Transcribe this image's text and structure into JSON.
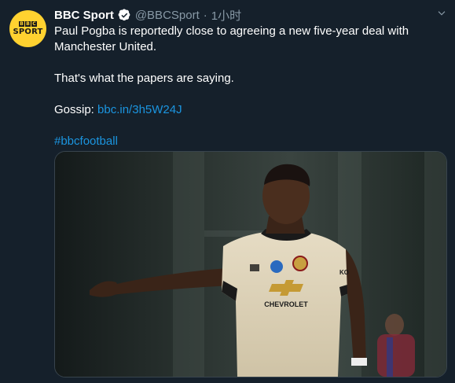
{
  "tweet": {
    "avatar": {
      "logo_letters": [
        "B",
        "B",
        "C"
      ],
      "logo_word": "SPORT",
      "brand_color": "#ffd230"
    },
    "display_name": "BBC Sport",
    "verified_icon": "verified-badge-icon",
    "handle": "@BBCSport",
    "separator": "·",
    "time": "1小时",
    "menu_icon": "chevron-down-icon",
    "lines": {
      "line1": "Paul Pogba is reportedly close to agreeing a new five-year deal with Manchester United.",
      "line2": "That's what the papers are saying.",
      "gossip_label": "Gossip: ",
      "gossip_link": "bbc.in/3h5W24J",
      "hashtag": "#bbcfootball"
    },
    "media": {
      "shirt_sponsor": "CHEVROLET",
      "shirt_brand": "KO"
    }
  },
  "colors": {
    "background": "#15202b",
    "text": "#ffffff",
    "muted": "#8899a6",
    "link": "#1b95e0",
    "verified": "#ffffff"
  }
}
